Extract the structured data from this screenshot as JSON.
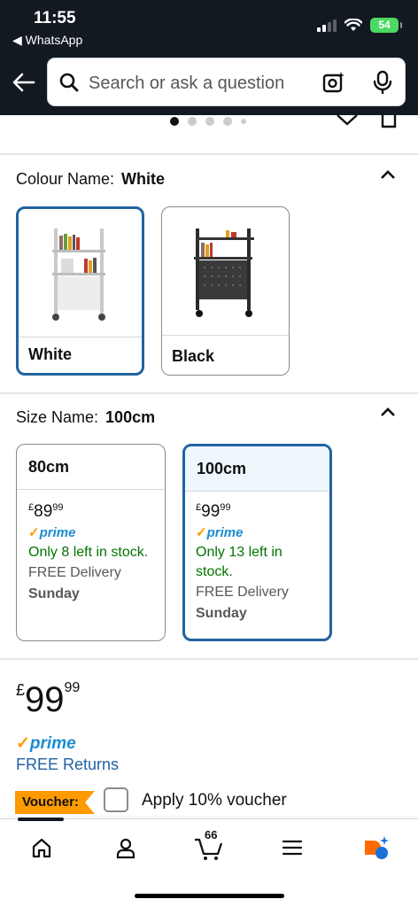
{
  "status_bar": {
    "time": "11:55",
    "back_app": "◀ WhatsApp",
    "battery": "54"
  },
  "search": {
    "placeholder": "Search or ask a question"
  },
  "colour": {
    "label": "Colour Name:",
    "selected": "White",
    "options": [
      {
        "name": "White",
        "selected": true
      },
      {
        "name": "Black",
        "selected": false
      }
    ]
  },
  "size": {
    "label": "Size Name:",
    "selected": "100cm",
    "options": [
      {
        "name": "80cm",
        "currency": "£",
        "price_whole": "89",
        "price_fraction": "99",
        "prime": "prime",
        "stock": "Only 8 left in stock.",
        "delivery": "FREE Delivery",
        "day": "Sunday",
        "selected": false
      },
      {
        "name": "100cm",
        "currency": "£",
        "price_whole": "99",
        "price_fraction": "99",
        "prime": "prime",
        "stock": "Only 13 left in stock.",
        "delivery": "FREE Delivery",
        "day": "Sunday",
        "selected": true
      }
    ]
  },
  "price": {
    "currency": "£",
    "whole": "99",
    "fraction": "99",
    "prime": "prime",
    "returns": "FREE Returns"
  },
  "voucher": {
    "badge": "Voucher:",
    "text": "Apply 10% voucher"
  },
  "nav": {
    "cart_count": "66",
    "items": [
      "home-icon",
      "account-icon",
      "cart-icon",
      "menu-icon",
      "rufus-icon"
    ]
  },
  "colors": {
    "header_bg": "#131921",
    "selected_border": "#2162a1",
    "prime_blue": "#1c8cd1",
    "stock_green": "#007600",
    "voucher_orange": "#ff9900"
  }
}
